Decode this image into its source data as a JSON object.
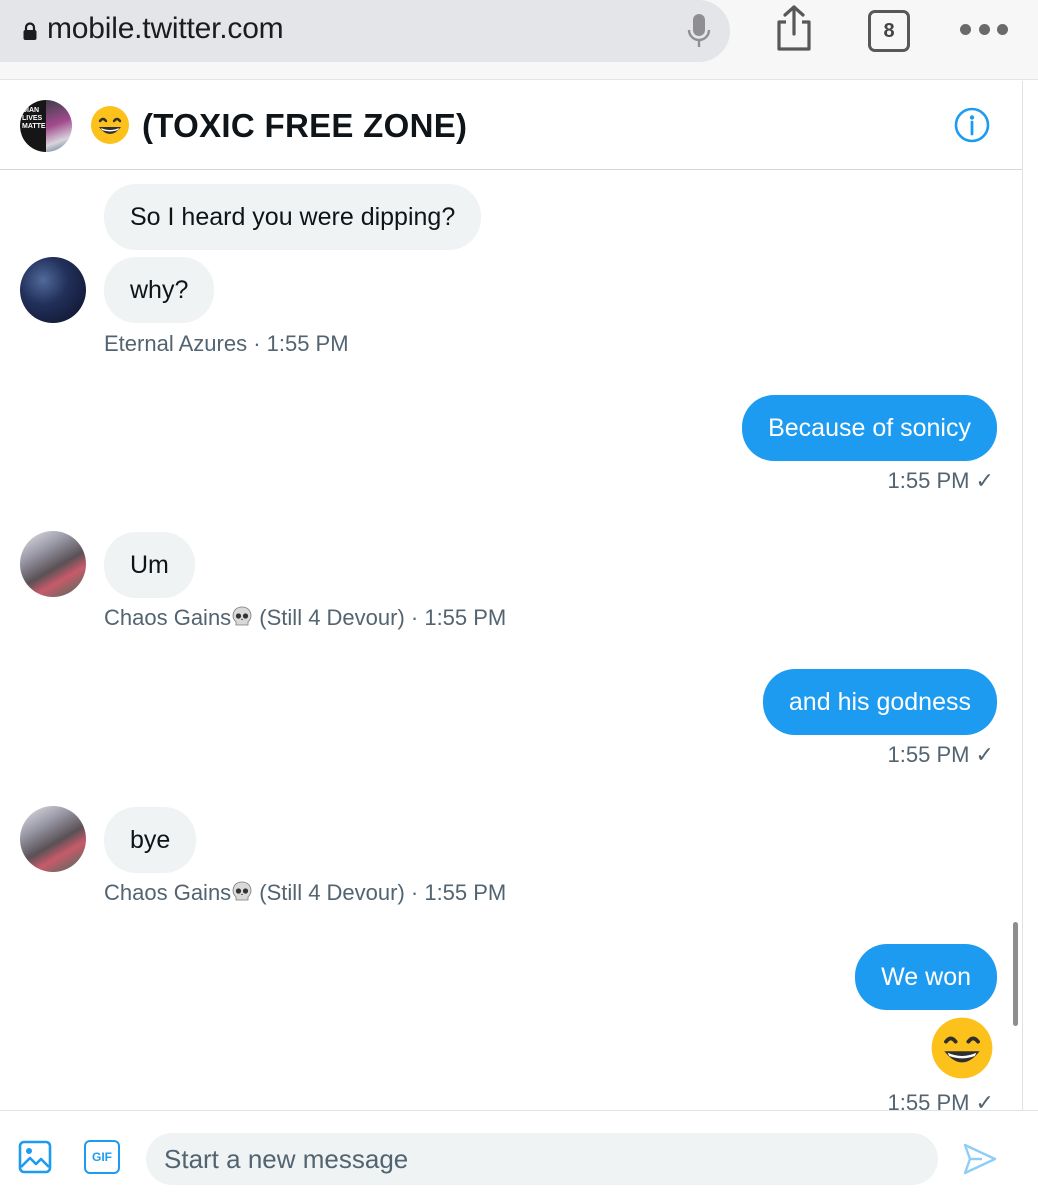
{
  "browser": {
    "url": "mobile.twitter.com",
    "tab_count": "8"
  },
  "conversation": {
    "title": "(TOXIC FREE ZONE)",
    "group_avatar_text": "DIAN LIVES MATTER"
  },
  "messages": [
    {
      "from": "Eternal Azures",
      "text": "So I heard you were dipping?"
    },
    {
      "from": "Eternal Azures",
      "text": "why?"
    },
    {
      "meta": "Eternal Azures · 1:55 PM"
    },
    {
      "from": "me",
      "text": "Because of sonicy",
      "meta": "1:55 PM ✓"
    },
    {
      "from": "Chaos Gains",
      "text": "Um",
      "meta_name": "Chaos Gains",
      "meta_suffix": " (Still 4 Devour) · 1:55 PM"
    },
    {
      "from": "me",
      "text": "and his godness",
      "meta": "1:55 PM ✓"
    },
    {
      "from": "Chaos Gains",
      "text": "bye",
      "meta_name": "Chaos Gains",
      "meta_suffix": " (Still 4 Devour) · 1:55 PM"
    },
    {
      "from": "me",
      "text": "We won",
      "meta": "1:55 PM ✓"
    }
  ],
  "compose": {
    "placeholder": "Start a new message",
    "gif_label": "GIF"
  },
  "icons": {
    "lock": "lock-icon",
    "mic": "microphone-icon",
    "share": "share-icon",
    "tabs": "tabs-icon",
    "more": "more-icon",
    "info": "info-icon",
    "image": "image-icon",
    "gif": "gif-icon",
    "send": "send-icon",
    "skull": "skull-emoji-icon",
    "grin": "grinning-emoji-icon"
  },
  "colors": {
    "accent": "#1d9bf0",
    "received_bubble": "#eff3f4",
    "meta_text": "#536471"
  }
}
